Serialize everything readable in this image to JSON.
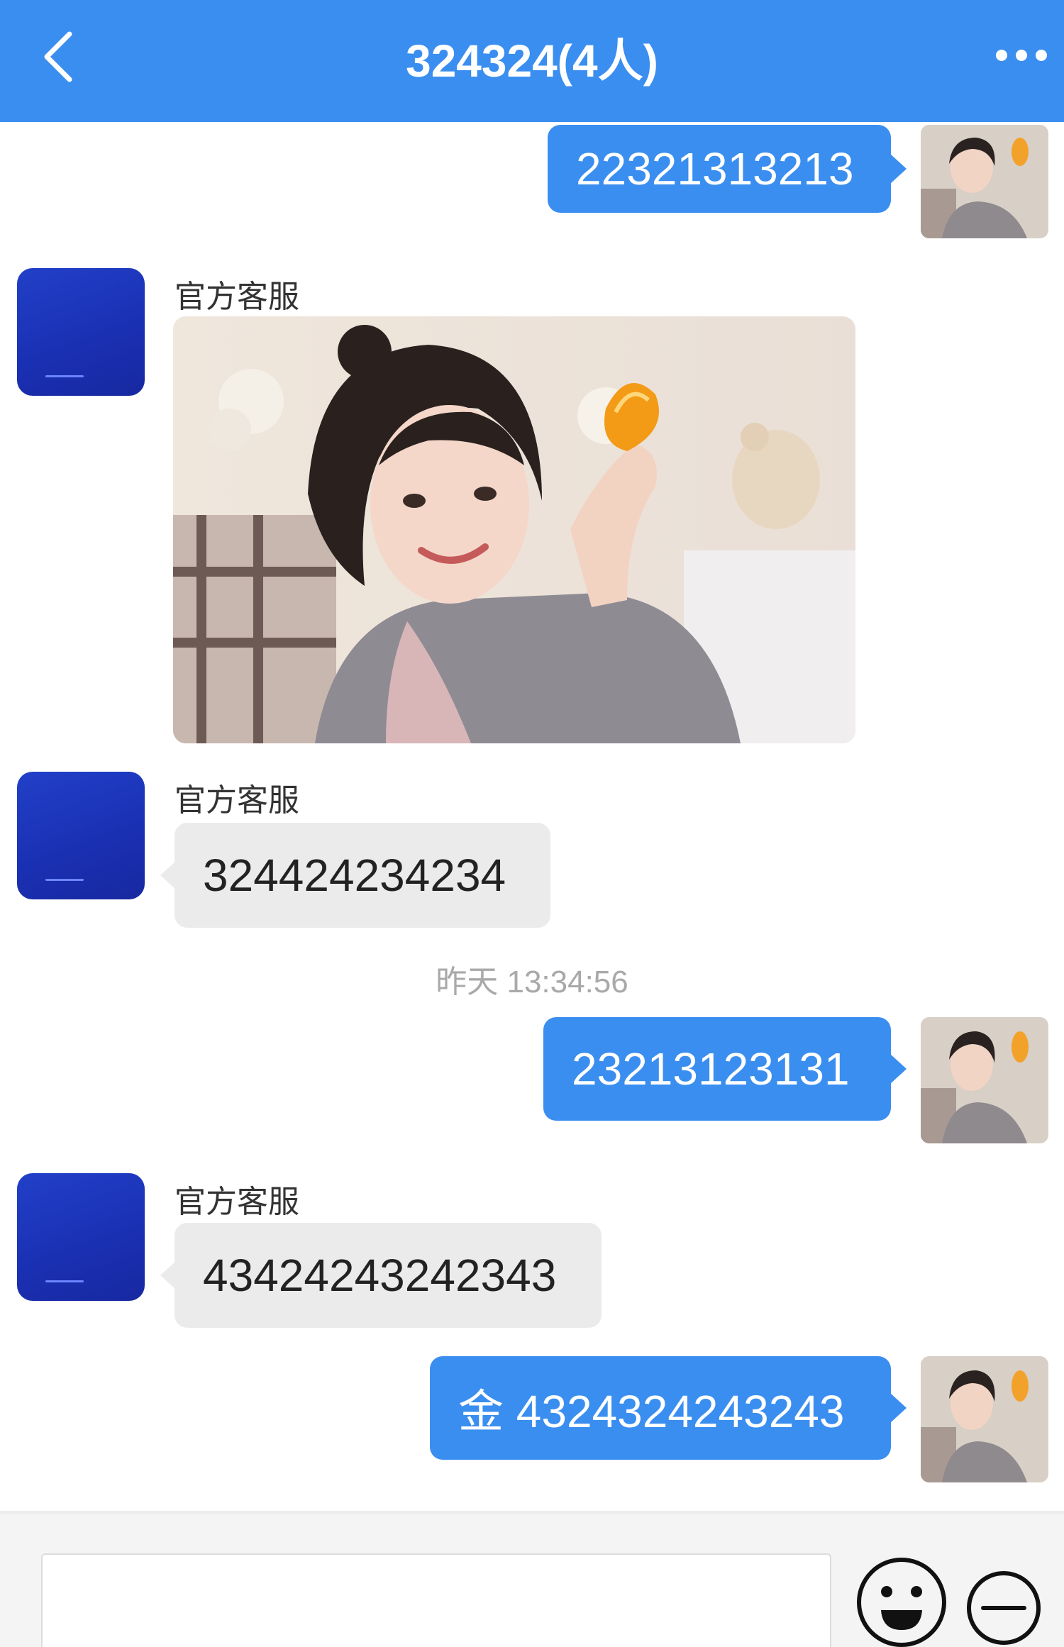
{
  "header": {
    "title": "324324(4人)"
  },
  "messages": {
    "m1": {
      "text": "22321313213"
    },
    "m2": {
      "sender": "官方客服"
    },
    "m3": {
      "sender": "官方客服",
      "text": "324424234234"
    },
    "ts": {
      "text": "昨天 13:34:56"
    },
    "m4": {
      "text": "23213123131"
    },
    "m5": {
      "sender": "官方客服",
      "text": "43424243242343"
    },
    "m6": {
      "text": "金 4324324243243"
    }
  },
  "colors": {
    "accent": "#3a8ef0",
    "bot_avatar": "#1a2fb2",
    "incoming_bubble": "#ebebeb"
  },
  "icons": {
    "back": "chevron-left-icon",
    "more": "more-dots-icon",
    "emoji": "emoji-smile-icon",
    "minus": "minus-circle-icon"
  }
}
